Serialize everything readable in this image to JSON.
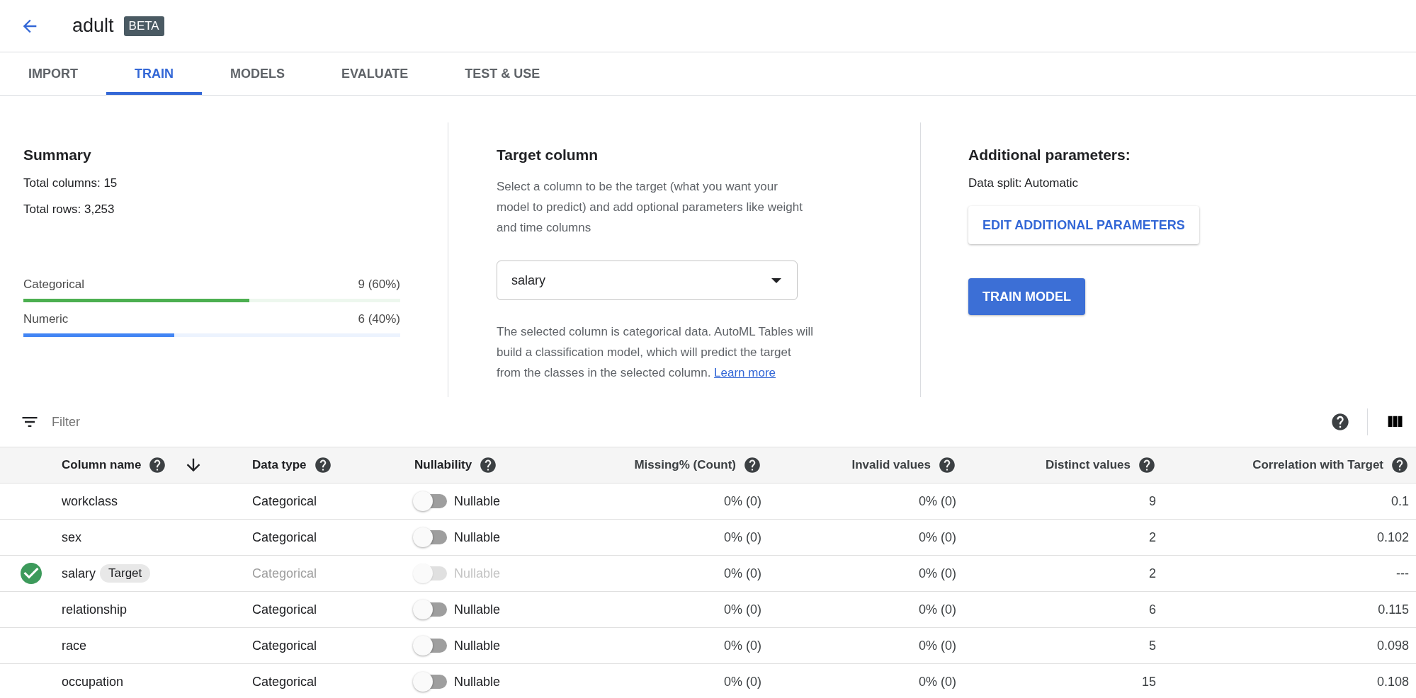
{
  "header": {
    "title": "adult",
    "badge": "BETA"
  },
  "tabs": [
    {
      "label": "IMPORT",
      "selected": false
    },
    {
      "label": "TRAIN",
      "selected": true
    },
    {
      "label": "MODELS",
      "selected": false
    },
    {
      "label": "EVALUATE",
      "selected": false
    },
    {
      "label": "TEST & USE",
      "selected": false
    }
  ],
  "summary": {
    "title": "Summary",
    "lines": [
      "Total columns: 15",
      "Total rows: 3,253"
    ],
    "bars": [
      {
        "label": "Categorical",
        "value": "9 (60%)",
        "level": 0.6,
        "color": "#4caf50"
      },
      {
        "label": "Numeric",
        "value": "6 (40%)",
        "level": 0.4,
        "color": "#4285f4"
      }
    ]
  },
  "target": {
    "title": "Target column",
    "description": "Select a column to be the target (what you want your model to predict) and add optional parameters like weight and time columns",
    "select_value": "salary",
    "note": "The selected column is categorical data. AutoML Tables will build a classification model, which will predict the target from the classes in the selected column.",
    "note_link": "Learn more"
  },
  "params": {
    "title": "Additional parameters:",
    "data_split": "Data split: Automatic",
    "edit_button": "EDIT ADDITIONAL PARAMETERS",
    "train_button": "TRAIN MODEL"
  },
  "filter": {
    "placeholder": "Filter"
  },
  "table": {
    "columns": [
      {
        "label": "Column name",
        "sorted": true
      },
      {
        "label": "Data type",
        "sorted": false
      },
      {
        "label": "Nullability",
        "sorted": false
      },
      {
        "label": "Missing% (Count)",
        "sorted": false
      },
      {
        "label": "Invalid values",
        "sorted": false
      },
      {
        "label": "Distinct values",
        "sorted": false
      },
      {
        "label": "Correlation with Target",
        "sorted": false
      }
    ],
    "rows": [
      {
        "name": "workclass",
        "target": false,
        "data_type": "Categorical",
        "nullable_label": "Nullable",
        "nullable": false,
        "disabled": false,
        "missing": "0% (0)",
        "invalid": "0% (0)",
        "distinct": "9",
        "correlation": "0.1"
      },
      {
        "name": "sex",
        "target": false,
        "data_type": "Categorical",
        "nullable_label": "Nullable",
        "nullable": false,
        "disabled": false,
        "missing": "0% (0)",
        "invalid": "0% (0)",
        "distinct": "2",
        "correlation": "0.102"
      },
      {
        "name": "salary",
        "target": true,
        "badge": "Target",
        "data_type": "Categorical",
        "nullable_label": "Nullable",
        "nullable": false,
        "disabled": true,
        "missing": "0% (0)",
        "invalid": "0% (0)",
        "distinct": "2",
        "correlation": "---"
      },
      {
        "name": "relationship",
        "target": false,
        "data_type": "Categorical",
        "nullable_label": "Nullable",
        "nullable": false,
        "disabled": false,
        "missing": "0% (0)",
        "invalid": "0% (0)",
        "distinct": "6",
        "correlation": "0.115"
      },
      {
        "name": "race",
        "target": false,
        "data_type": "Categorical",
        "nullable_label": "Nullable",
        "nullable": false,
        "disabled": false,
        "missing": "0% (0)",
        "invalid": "0% (0)",
        "distinct": "5",
        "correlation": "0.098"
      },
      {
        "name": "occupation",
        "target": false,
        "data_type": "Categorical",
        "nullable_label": "Nullable",
        "nullable": false,
        "disabled": false,
        "missing": "0% (0)",
        "invalid": "0% (0)",
        "distinct": "15",
        "correlation": "0.108"
      }
    ]
  }
}
